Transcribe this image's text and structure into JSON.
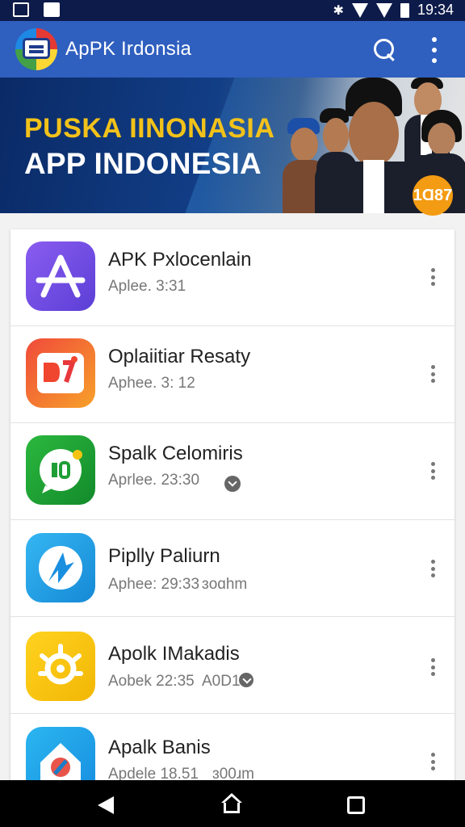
{
  "status_bar": {
    "time": "19:34"
  },
  "app_bar": {
    "title": "ApPK Irdonsia"
  },
  "banner": {
    "title": "PUSKA IINONASIA",
    "subtitle": "APP INDONESIA",
    "badge": "1Ɑ87"
  },
  "apps": [
    {
      "name": "APK Pxlocenlain",
      "meta": "Aplee. 3:31",
      "extra": "",
      "icon": "app-store-icon",
      "color": "#7b52e0"
    },
    {
      "name": "Oplaiitiar Resaty",
      "meta": "Aphee. 3: 12",
      "extra": "",
      "icon": "media-icon",
      "color": "#f0452f"
    },
    {
      "name": "Spalk Celomiris",
      "meta": "Aprlee. 23:30",
      "extra": "",
      "icon": "chat-icon",
      "color": "#1e9e35"
    },
    {
      "name": "Piplly Paliurn",
      "meta": "Aphee: 29:33",
      "extra": "ɜoɑhm",
      "icon": "compass-icon",
      "color": "#1a9ee6"
    },
    {
      "name": "Apolk IMakadis",
      "meta": "Aobek 22:35",
      "extra": "A0D1",
      "icon": "sun-icon",
      "color": "#f5c313"
    },
    {
      "name": "Apalk Banis",
      "meta": "Apdele 18.51",
      "extra": "ɜ00ɹm",
      "icon": "home-icon",
      "color": "#1aa7e8"
    }
  ]
}
